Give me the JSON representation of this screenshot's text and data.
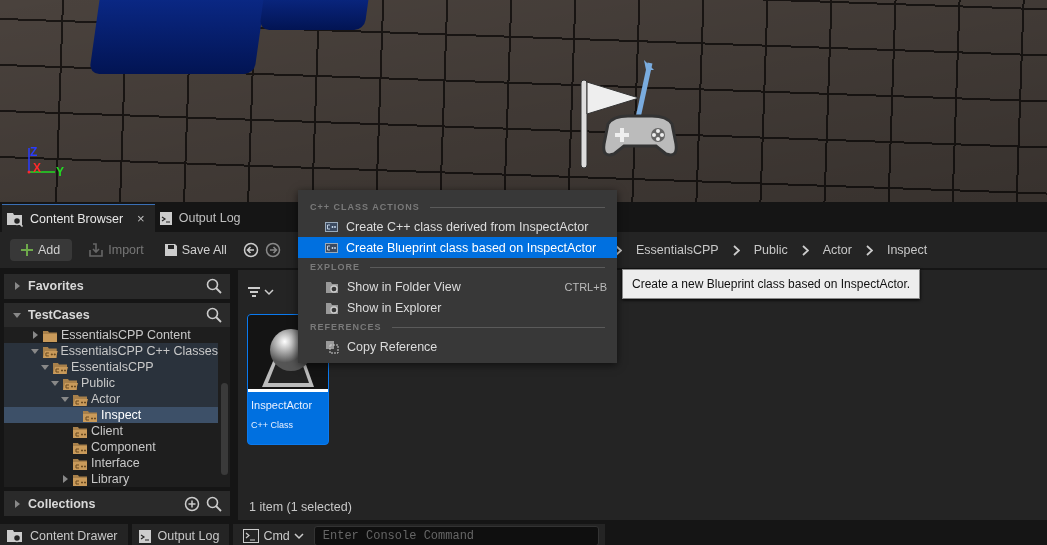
{
  "viewport": {
    "axes": [
      {
        "label": "Z",
        "color": "#2a3cff"
      },
      {
        "label": "X",
        "color": "#ff2a2a"
      },
      {
        "label": "Y",
        "color": "#22dd22"
      }
    ]
  },
  "tabs": [
    {
      "label": "Content Browser",
      "selected": true,
      "close": "×"
    },
    {
      "label": "Output Log",
      "selected": false
    }
  ],
  "toolbar": {
    "buttons": [
      {
        "label": "Add",
        "kind": "add",
        "disabled": false
      },
      {
        "label": "Import",
        "kind": "import",
        "disabled": true
      },
      {
        "label": "Save All",
        "kind": "save",
        "disabled": false
      }
    ],
    "breadcrumb": [
      "EssentialsCPP",
      "Public",
      "Actor",
      "Inspect"
    ]
  },
  "sidebar": {
    "sections": [
      {
        "title": "Favorites",
        "expanded": false,
        "kind": "search"
      },
      {
        "title": "TestCases",
        "expanded": true,
        "kind": "search",
        "tree": [
          {
            "label": "EssentialsCPP Content",
            "kind": "content",
            "expanded": false,
            "highlighted": false,
            "selected": false
          },
          {
            "label": "EssentialsCPP C++ Classes",
            "kind": "classes",
            "expanded": true,
            "highlighted": true,
            "selected": false,
            "children": [
              {
                "label": "EssentialsCPP",
                "kind": "classes",
                "expanded": true,
                "highlighted": true,
                "selected": false,
                "children": [
                  {
                    "label": "Public",
                    "kind": "classes",
                    "expanded": true,
                    "highlighted": true,
                    "selected": false,
                    "children": [
                      {
                        "label": "Actor",
                        "kind": "classes",
                        "expanded": true,
                        "highlighted": true,
                        "selected": false,
                        "children": [
                          {
                            "label": "Inspect",
                            "kind": "classes",
                            "highlighted": false,
                            "selected": true
                          }
                        ]
                      },
                      {
                        "label": "Client",
                        "kind": "classes",
                        "highlighted": false,
                        "selected": false
                      },
                      {
                        "label": "Component",
                        "kind": "classes",
                        "highlighted": false,
                        "selected": false
                      },
                      {
                        "label": "Interface",
                        "kind": "classes",
                        "highlighted": false,
                        "selected": false
                      },
                      {
                        "label": "Library",
                        "kind": "classes",
                        "expanded": false,
                        "highlighted": false,
                        "selected": false
                      }
                    ]
                  }
                ]
              }
            ]
          }
        ]
      },
      {
        "title": "Collections",
        "expanded": false,
        "kind": "add-search"
      }
    ]
  },
  "content": {
    "assets": [
      {
        "name": "InspectActor",
        "type": "C++ Class",
        "selected": true
      }
    ],
    "status": "1 item (1 selected)"
  },
  "bottom_bar": {
    "buttons": [
      {
        "label": "Content Drawer",
        "kind": "drawer"
      },
      {
        "label": "Output Log",
        "kind": "log"
      }
    ],
    "cmd": "Cmd",
    "console_placeholder": "Enter Console Command"
  },
  "context_menu": {
    "sections": [
      {
        "header": "C++ CLASS ACTIONS",
        "items": [
          {
            "label": "Create C++ class derived from InspectActor",
            "selected": false
          },
          {
            "label": "Create Blueprint class based on InspectActor",
            "selected": true
          }
        ]
      },
      {
        "header": "EXPLORE",
        "items": [
          {
            "label": "Show in Folder View",
            "shortcut": "CTRL+B",
            "selected": false
          },
          {
            "label": "Show in Explorer",
            "selected": false
          }
        ]
      },
      {
        "header": "REFERENCES",
        "items": [
          {
            "label": "Copy Reference",
            "selected": false
          }
        ]
      }
    ]
  },
  "tooltip": "Create a new Blueprint class based on InspectActor."
}
